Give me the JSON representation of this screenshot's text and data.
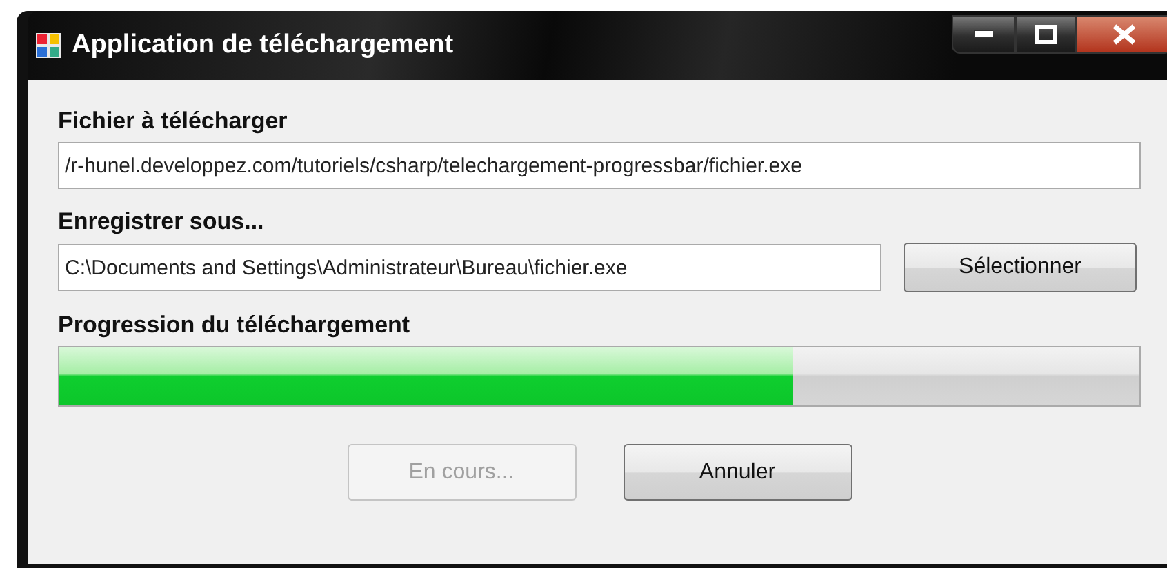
{
  "window": {
    "title": "Application de téléchargement"
  },
  "source": {
    "label": "Fichier à télécharger",
    "value": "/r-hunel.developpez.com/tutoriels/csharp/telechargement-progressbar/fichier.exe"
  },
  "destination": {
    "label": "Enregistrer sous...",
    "value": "C:\\Documents and Settings\\Administrateur\\Bureau\\fichier.exe",
    "button": "Sélectionner"
  },
  "progress": {
    "label": "Progression du téléchargement",
    "level": 0.68
  },
  "buttons": [
    {
      "label": "En cours...",
      "disabled": true
    },
    {
      "label": "Annuler",
      "disabled": false
    }
  ]
}
